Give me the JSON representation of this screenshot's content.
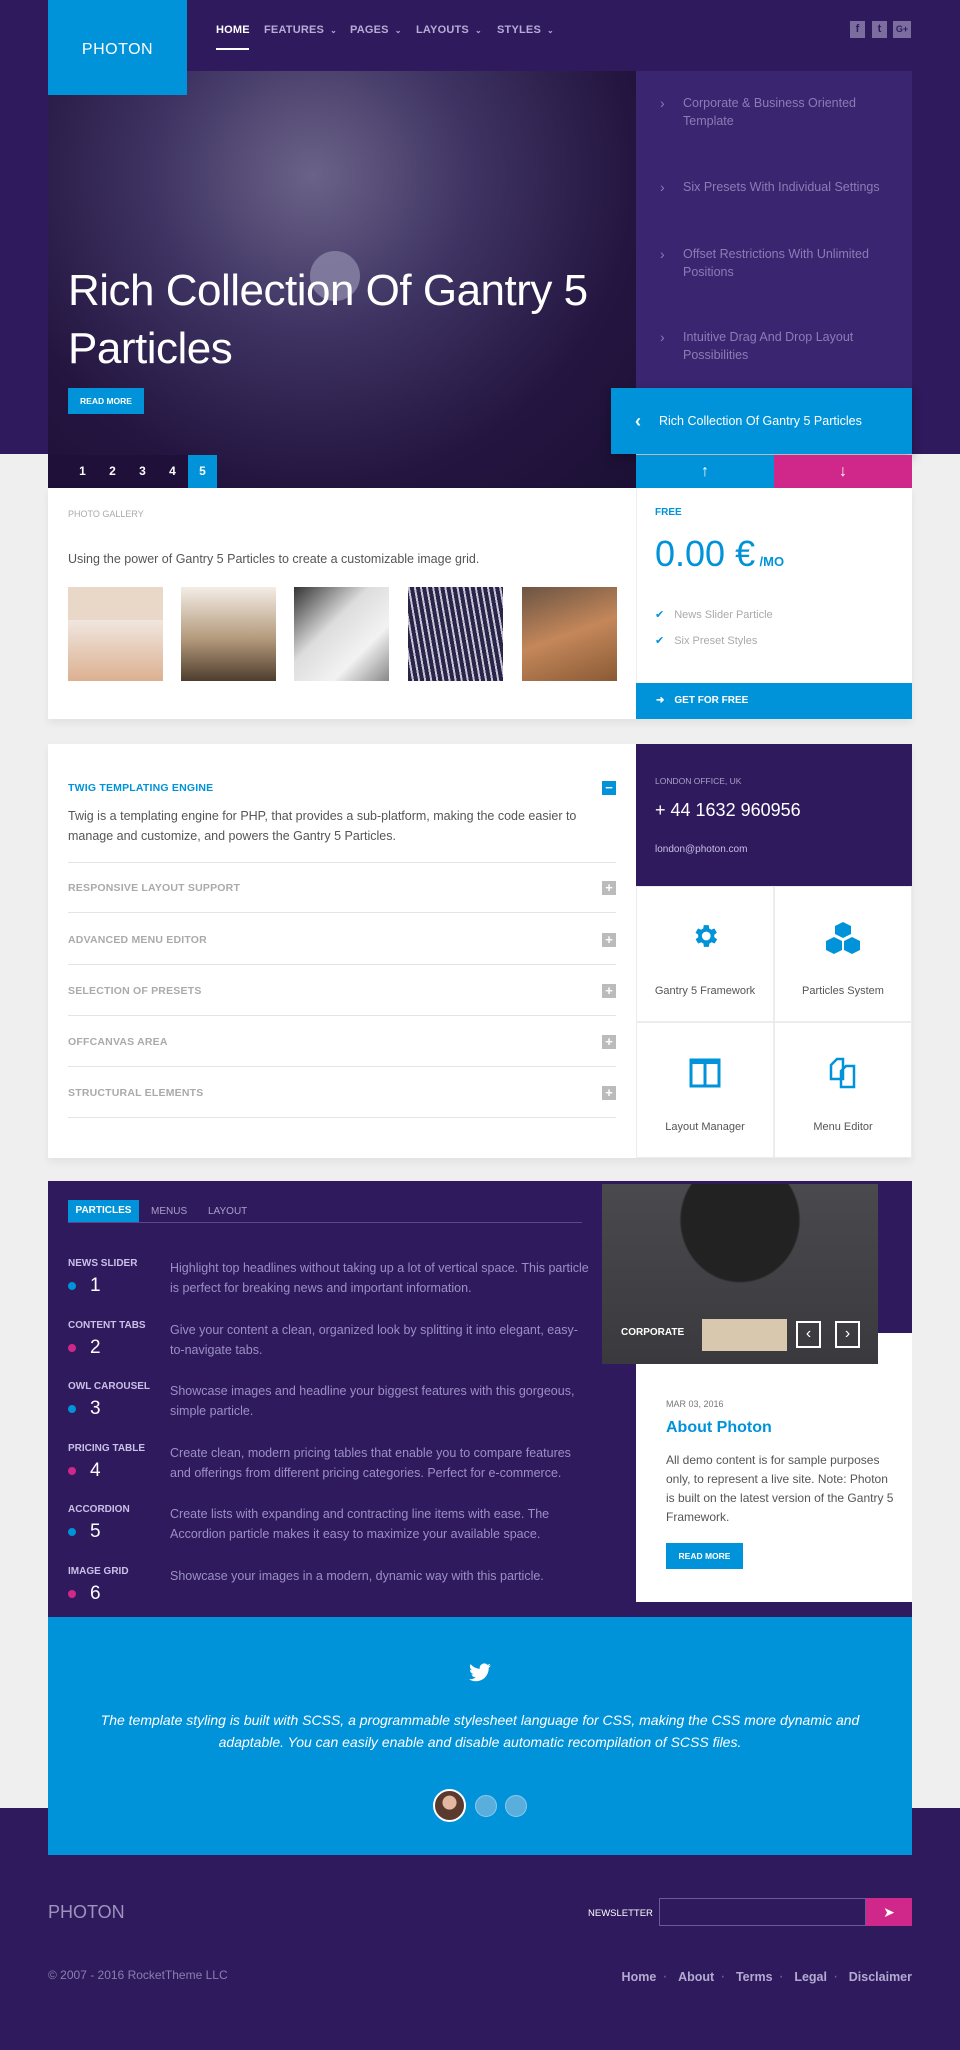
{
  "colors": {
    "purple": "#2f1a5e",
    "blue": "#0093d9",
    "pink": "#d0288a",
    "background": "#efefef"
  },
  "header": {
    "logo": "PHOTON",
    "nav": [
      {
        "label": "HOME",
        "active": true
      },
      {
        "label": "FEATURES"
      },
      {
        "label": "PAGES"
      },
      {
        "label": "LAYOUTS"
      },
      {
        "label": "STYLES"
      }
    ],
    "social": [
      {
        "icon": "facebook-icon",
        "glyph": "f"
      },
      {
        "icon": "twitter-icon",
        "glyph": "t"
      },
      {
        "icon": "google-plus-icon",
        "glyph": "G+"
      }
    ]
  },
  "hero": {
    "title": "Rich Collection Of Gantry 5 Particles",
    "read_more": "READ MORE",
    "pages": [
      "1",
      "2",
      "3",
      "4",
      "5"
    ],
    "active_page": "5",
    "features": [
      "Corporate & Business Oriented Template",
      "Six Presets With Individual Settings",
      "Offset Restrictions With Unlimited Positions",
      "Intuitive Drag And Drop Layout Possibilities"
    ],
    "callout": "Rich Collection Of Gantry 5 Particles"
  },
  "gallery": {
    "label": "PHOTO GALLERY",
    "text": "Using the power of Gantry 5 Particles to create a customizable image grid."
  },
  "pricing": {
    "label": "FREE",
    "price": "0.00 €",
    "period": "/MO",
    "features": [
      "News Slider Particle",
      "Six Preset Styles"
    ],
    "button": "GET FOR FREE"
  },
  "accordion": {
    "open": {
      "title": "TWIG TEMPLATING ENGINE",
      "text": "Twig is a templating engine for PHP, that provides a sub-platform, making the code easier to manage and customize, and powers the Gantry 5 Particles."
    },
    "items": [
      "RESPONSIVE LAYOUT SUPPORT",
      "ADVANCED MENU EDITOR",
      "SELECTION OF PRESETS",
      "OFFCANVAS AREA",
      "STRUCTURAL ELEMENTS"
    ]
  },
  "contact": {
    "label": "LONDON OFFICE, UK",
    "phone": "+ 44 1632 960956",
    "email": "london@photon.com"
  },
  "features_grid": [
    {
      "icon": "gear-icon",
      "label": "Gantry 5 Framework"
    },
    {
      "icon": "cubes-icon",
      "label": "Particles System"
    },
    {
      "icon": "columns-icon",
      "label": "Layout Manager"
    },
    {
      "icon": "copy-icon",
      "label": "Menu Editor"
    }
  ],
  "tabs": {
    "items": [
      "PARTICLES",
      "MENUS",
      "LAYOUT"
    ],
    "active": "PARTICLES",
    "particles": [
      {
        "name": "NEWS SLIDER",
        "num": "1",
        "desc": "Highlight top headlines without taking up a lot of vertical space. This particle is perfect for breaking news and important information."
      },
      {
        "name": "CONTENT TABS",
        "num": "2",
        "desc": "Give your content a clean, organized look by splitting it into elegant, easy-to-navigate tabs."
      },
      {
        "name": "OWL CAROUSEL",
        "num": "3",
        "desc": "Showcase images and headline your biggest features with this gorgeous, simple particle."
      },
      {
        "name": "PRICING TABLE",
        "num": "4",
        "desc": "Create clean, modern pricing tables that enable you to compare features and offerings from different pricing categories. Perfect for e-commerce."
      },
      {
        "name": "ACCORDION",
        "num": "5",
        "desc": "Create lists with expanding and contracting line items with ease. The Accordion particle makes it easy to maximize your available space."
      },
      {
        "name": "IMAGE GRID",
        "num": "6",
        "desc": "Showcase your images in a modern, dynamic way with this particle."
      }
    ]
  },
  "blog": {
    "image_label": "CORPORATE",
    "date": "MAR 03, 2016",
    "title": "About Photon",
    "text": "All demo content is for sample purposes only, to represent a live site. Note: Photon is built on the latest version of the Gantry 5 Framework.",
    "button": "READ MORE"
  },
  "testimonial": {
    "quote": "The template styling is built with SCSS, a programmable stylesheet language for CSS, making the CSS more dynamic and adaptable. You can easily enable and disable automatic recompilation of SCSS files."
  },
  "footer": {
    "logo": "PHOTON",
    "newsletter_label": "NEWSLETTER",
    "newsletter_placeholder": "",
    "copyright": "© 2007 - 2016 RocketTheme LLC",
    "links": [
      "Home",
      "About",
      "Terms",
      "Legal",
      "Disclaimer"
    ]
  }
}
